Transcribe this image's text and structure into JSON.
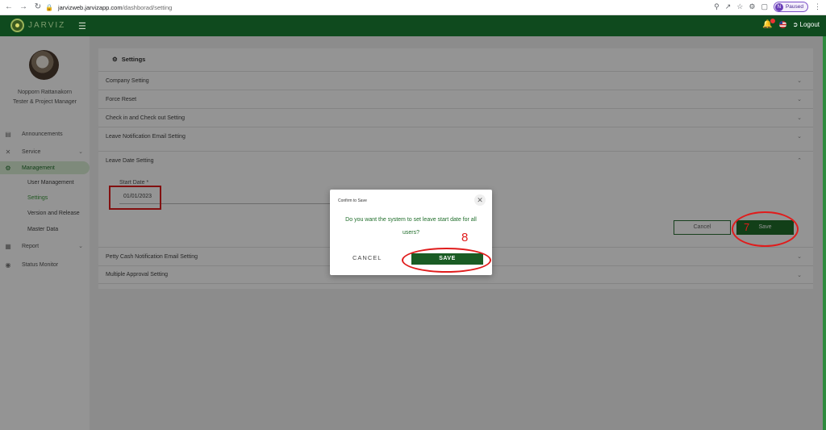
{
  "browser": {
    "url_host": "jarvizweb.jarvizapp.com",
    "url_path": "/dashborad/setting",
    "profile_initial": "N",
    "profile_status": "Paused"
  },
  "header": {
    "logo_text": "JARVIZ",
    "logout_label": "Logout"
  },
  "user": {
    "name": "Nopporn Rattanakorn",
    "role": "Tester & Project Manager"
  },
  "sidebar": {
    "items": [
      {
        "label": "Announcements"
      },
      {
        "label": "Service"
      },
      {
        "label": "Management"
      },
      {
        "label": "Report"
      },
      {
        "label": "Status Monitor"
      }
    ],
    "subitems": [
      {
        "label": "User Management"
      },
      {
        "label": "Settings"
      },
      {
        "label": "Version and Release"
      },
      {
        "label": "Master Data"
      }
    ]
  },
  "settings": {
    "title": "Settings",
    "sections": [
      {
        "label": "Company Setting"
      },
      {
        "label": "Force Reset"
      },
      {
        "label": "Check in and Check out Setting"
      },
      {
        "label": "Leave Notification Email Setting"
      },
      {
        "label": "Leave Date Setting"
      },
      {
        "label": "Petty Cash Notification Email Setting"
      },
      {
        "label": "Multiple Approval Setting"
      }
    ],
    "start_date_label": "Start Date *",
    "start_date_value": "01/01/2023",
    "cancel_label": "Cancel",
    "save_label": "Save"
  },
  "modal": {
    "title": "Confirm to Save",
    "message": "Do you want the system to set leave start date for all users?",
    "cancel_label": "CANCEL",
    "save_label": "SAVE"
  },
  "annotations": {
    "step7": "7",
    "step8": "8"
  },
  "colors": {
    "brand": "#0f4a1e",
    "accent": "#1f6d2a",
    "annotation": "#e01c1c"
  }
}
